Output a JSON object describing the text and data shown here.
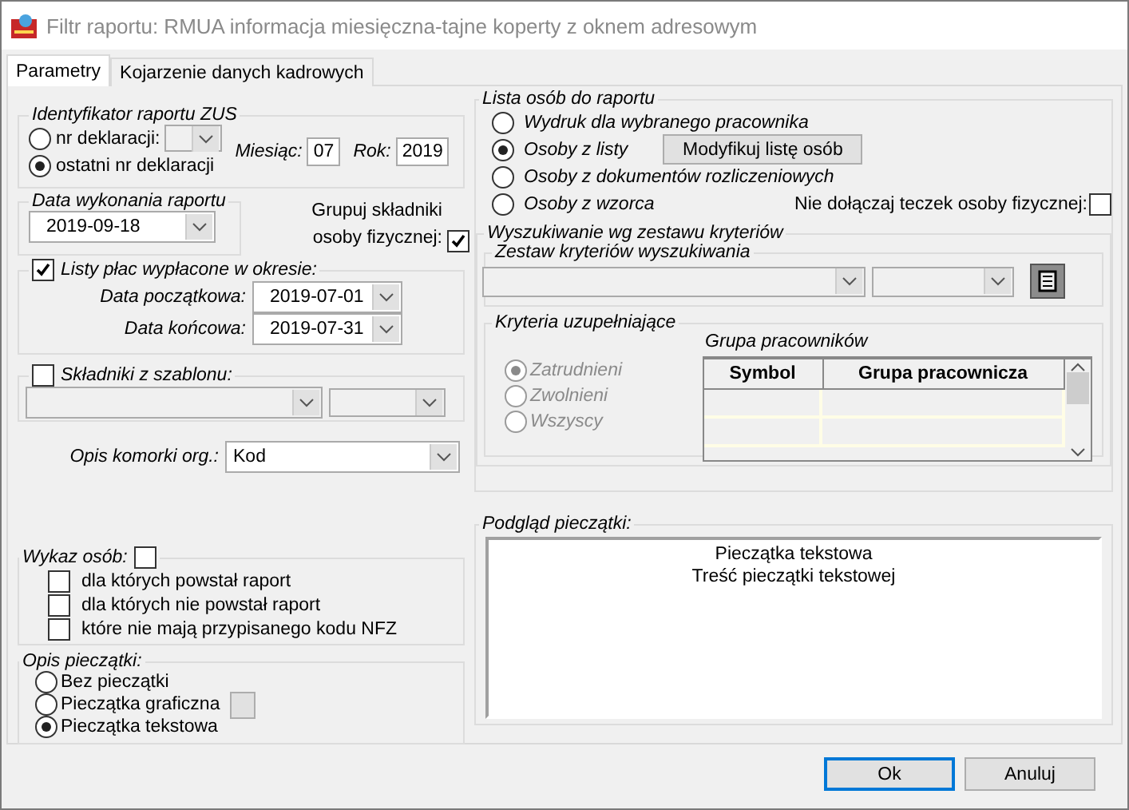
{
  "window": {
    "title": "Filtr raportu: RMUA informacja miesięczna-tajne koperty z oknem adresowym"
  },
  "tabs": [
    {
      "label": "Parametry",
      "selected": true
    },
    {
      "label": "Kojarzenie danych kadrowych",
      "selected": false
    }
  ],
  "zus_id": {
    "legend": "Identyfikator raportu ZUS",
    "options": [
      {
        "label": "nr deklaracji:",
        "selected": false,
        "kind": "with_dropdown"
      },
      {
        "label": "ostatni nr deklaracji",
        "selected": true,
        "kind": "plain"
      }
    ],
    "month_label": "Miesiąc:",
    "month": "07",
    "year_label": "Rok:",
    "year": "2019"
  },
  "execution_date": {
    "legend": "Data wykonania raportu",
    "value": "2019-09-18"
  },
  "group_components": {
    "label": "Grupuj składniki osoby fizycznej:",
    "checked": true
  },
  "payroll_period": {
    "label": "Listy płac wypłacone w okresie:",
    "checked": true,
    "start_label": "Data początkowa:",
    "start": "2019-07-01",
    "end_label": "Data końcowa:",
    "end": "2019-07-31"
  },
  "template_components": {
    "label": "Składniki z szablonu:",
    "checked": false
  },
  "org_unit": {
    "label": "Opis komorki org.:",
    "value": "Kod"
  },
  "people_list": {
    "label": "Wykaz osób:",
    "checked": false,
    "options": [
      {
        "label": "dla których powstał raport",
        "checked": false
      },
      {
        "label": "dla których nie powstał raport",
        "checked": false
      },
      {
        "label": "które nie mają przypisanego kodu NFZ",
        "checked": false
      }
    ]
  },
  "stamp": {
    "legend": "Opis pieczątki:",
    "options": [
      {
        "label": "Bez pieczątki",
        "selected": false,
        "kind": "plain"
      },
      {
        "label": "Pieczątka graficzna",
        "selected": false,
        "kind": "with_button"
      },
      {
        "label": "Pieczątka tekstowa",
        "selected": true,
        "kind": "plain"
      }
    ]
  },
  "report_people": {
    "legend": "Lista osób do raportu",
    "options": [
      {
        "label": "Wydruk dla wybranego pracownika",
        "selected": false,
        "kind": "plain"
      },
      {
        "label": "Osoby z listy",
        "selected": true,
        "kind": "with_button"
      },
      {
        "label": "Osoby z dokumentów rozliczeniowych",
        "selected": false,
        "kind": "plain"
      },
      {
        "label": "Osoby z wzorca",
        "selected": false,
        "kind": "with_checkbox"
      }
    ],
    "modify_button": "Modyfikuj listę osób",
    "exclude_files": {
      "label": "Nie dołączaj teczek osoby fizycznej:",
      "checked": false
    }
  },
  "search": {
    "legend": "Wyszukiwanie wg zestawu kryteriów",
    "criteria_set_legend": "Zestaw kryteriów wyszukiwania",
    "extra": {
      "legend": "Kryteria uzupełniające",
      "options": [
        {
          "label": "Zatrudnieni",
          "selected": true,
          "disabled": true
        },
        {
          "label": "Zwolnieni",
          "selected": false,
          "disabled": true
        },
        {
          "label": "Wszyscy",
          "selected": false,
          "disabled": true
        }
      ],
      "group_title": "Grupa pracowników",
      "columns": [
        "Symbol",
        "Grupa pracownicza"
      ]
    }
  },
  "stamp_preview": {
    "legend": "Podgląd pieczątki:",
    "lines": [
      "Pieczątka tekstowa",
      "Treść pieczątki tekstowej"
    ]
  },
  "buttons": [
    {
      "label": "Ok",
      "default": true
    },
    {
      "label": "Anuluj",
      "default": false
    }
  ]
}
